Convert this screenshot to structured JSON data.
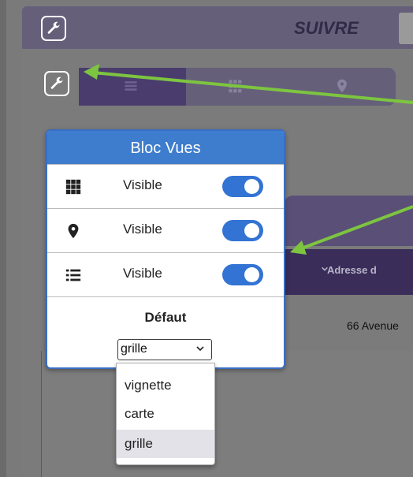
{
  "header": {
    "title": "SUIVRE"
  },
  "icons": {
    "settings": "wrench-icon",
    "views": [
      "list-icon",
      "grid-icon",
      "map-pin-icon"
    ]
  },
  "table": {
    "column_header": "Adresse d",
    "cell_address": "66 Avenue"
  },
  "popover": {
    "title": "Bloc Vues",
    "rows": [
      {
        "icon": "grid-icon",
        "label": "Visible",
        "enabled": true
      },
      {
        "icon": "map-pin-icon",
        "label": "Visible",
        "enabled": true
      },
      {
        "icon": "list-icon",
        "label": "Visible",
        "enabled": true
      }
    ],
    "default_label": "Défaut",
    "default_select": {
      "value": "grille",
      "options": [
        "vignette",
        "carte",
        "grille"
      ]
    }
  },
  "colors": {
    "accent": "#3e7dce",
    "toggle": "#3273d3",
    "arrow": "#7dc540",
    "header_bg": "#3a2d5a"
  }
}
